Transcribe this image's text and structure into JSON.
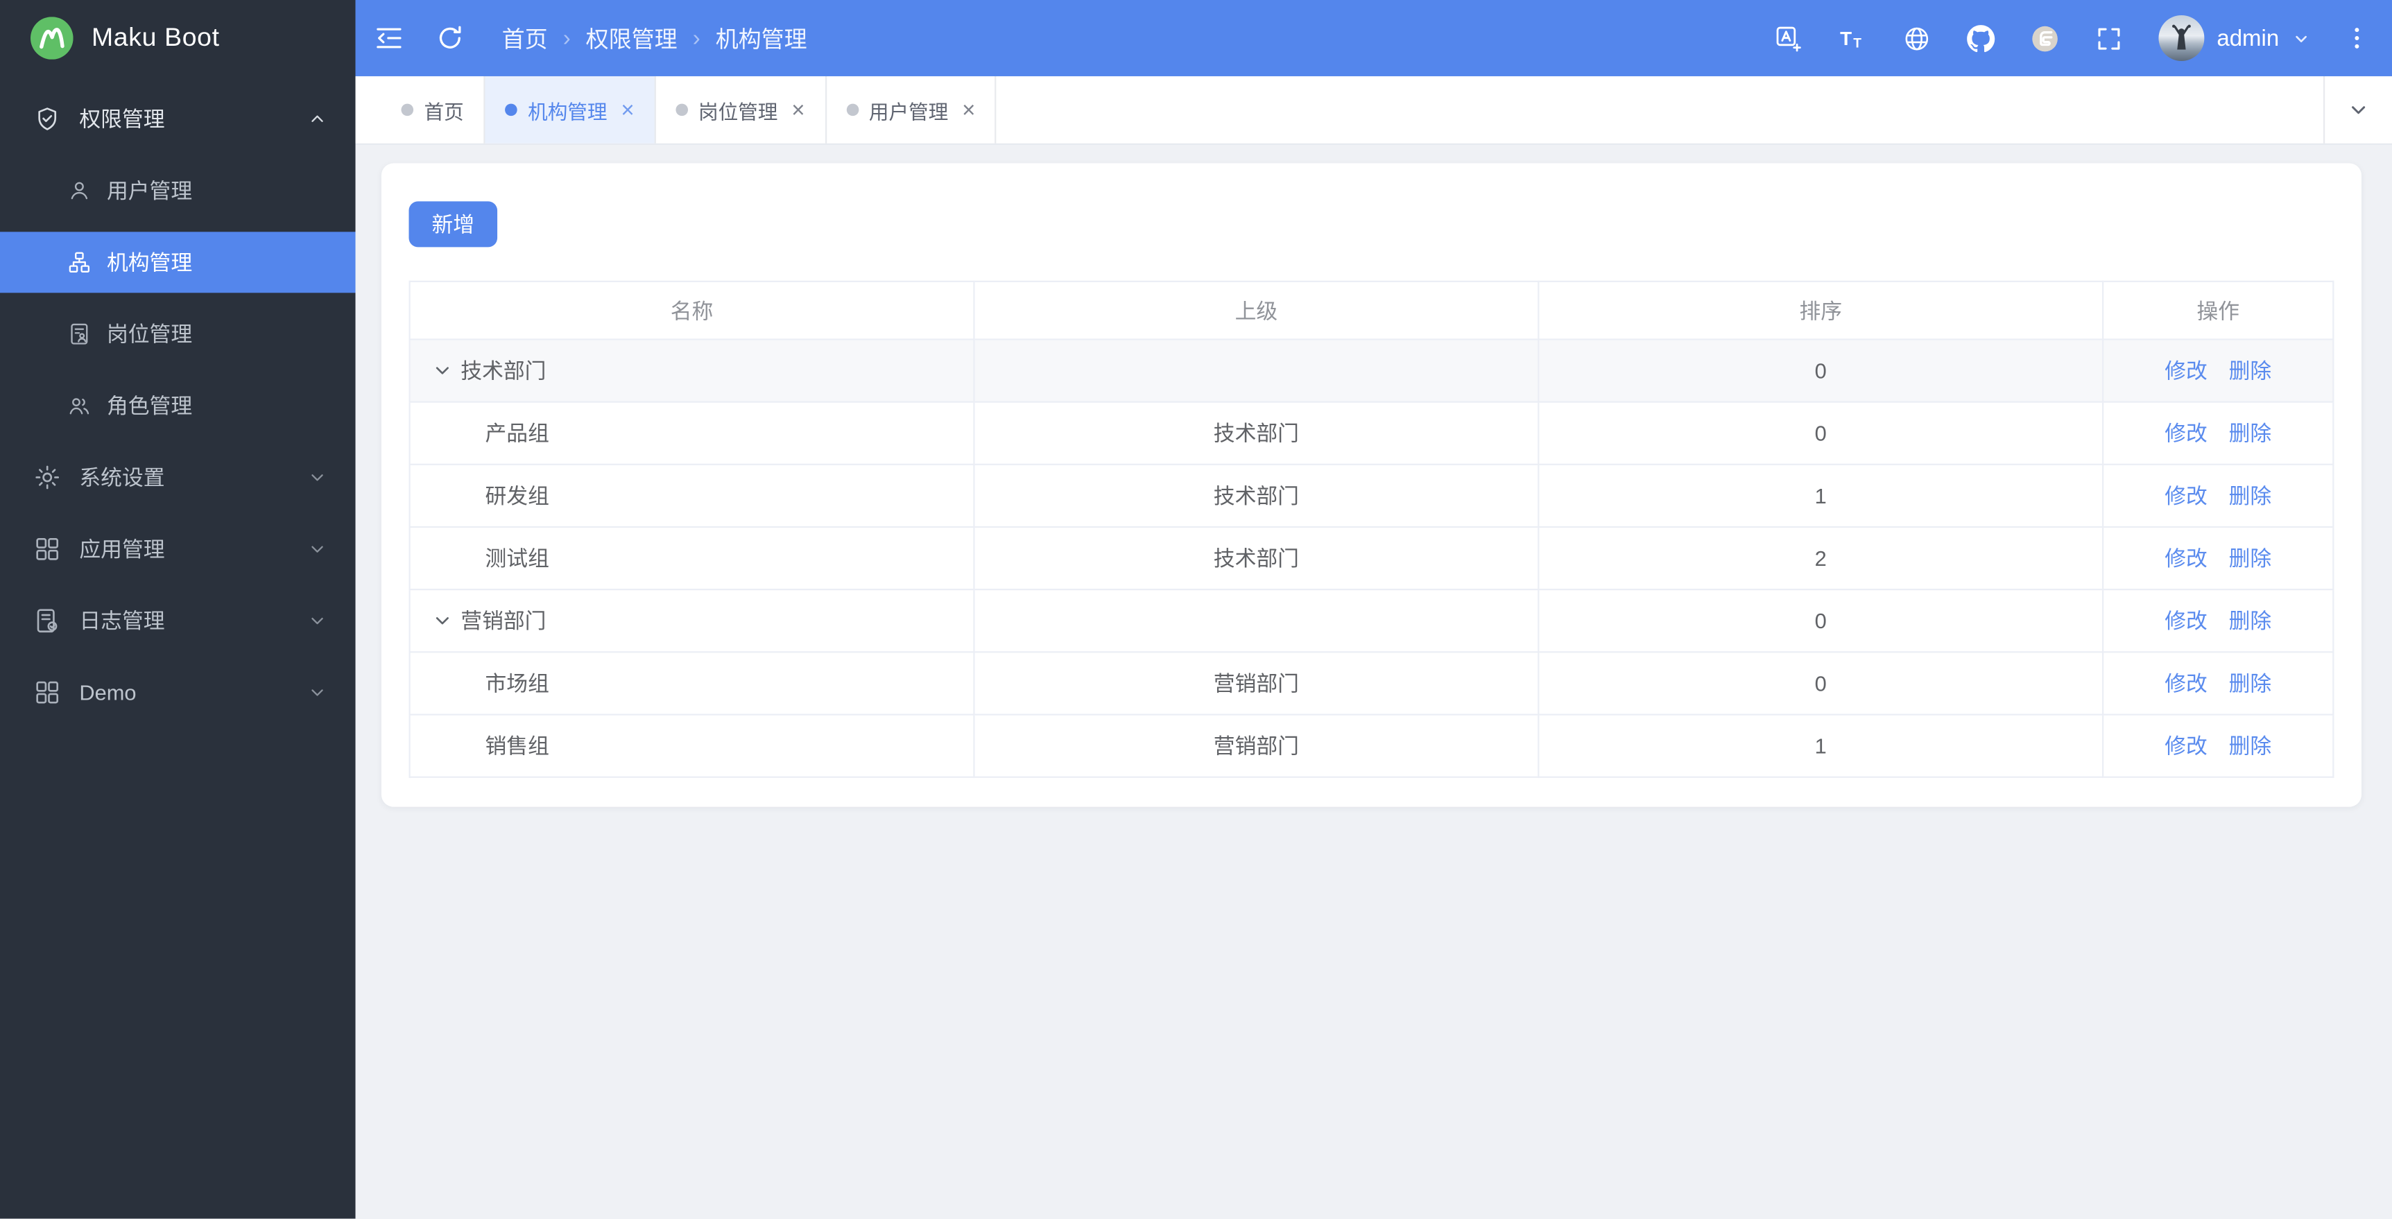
{
  "app": {
    "name": "Maku Boot",
    "logo_icon": "mountain-logo-icon"
  },
  "topbar": {
    "left_icons": [
      "sidebar-fold-icon",
      "refresh-icon"
    ],
    "breadcrumb": [
      "首页",
      "权限管理",
      "机构管理"
    ],
    "right_icons": [
      "translate-icon",
      "font-size-icon",
      "globe-icon",
      "github-icon",
      "gitee-icon",
      "fullscreen-icon"
    ],
    "username": "admin",
    "user_menu_icon": "chevron-down-icon",
    "more_icon": "more-vertical-icon"
  },
  "sidebar": {
    "sections": [
      {
        "key": "permissions",
        "label": "权限管理",
        "icon": "shield-check-icon",
        "expanded": true,
        "children": [
          {
            "key": "users",
            "label": "用户管理",
            "icon": "user-icon",
            "active": false
          },
          {
            "key": "orgs",
            "label": "机构管理",
            "icon": "org-chart-icon",
            "active": true
          },
          {
            "key": "posts",
            "label": "岗位管理",
            "icon": "post-icon",
            "active": false
          },
          {
            "key": "roles",
            "label": "角色管理",
            "icon": "roles-icon",
            "active": false
          }
        ]
      },
      {
        "key": "system",
        "label": "系统设置",
        "icon": "gear-icon",
        "expanded": false,
        "children": []
      },
      {
        "key": "apps",
        "label": "应用管理",
        "icon": "grid-icon",
        "expanded": false,
        "children": []
      },
      {
        "key": "logs",
        "label": "日志管理",
        "icon": "log-icon",
        "expanded": false,
        "children": []
      },
      {
        "key": "demo",
        "label": "Demo",
        "icon": "grid-icon",
        "expanded": false,
        "children": []
      }
    ]
  },
  "tabs": [
    {
      "label": "首页",
      "active": false,
      "closable": false
    },
    {
      "label": "机构管理",
      "active": true,
      "closable": true
    },
    {
      "label": "岗位管理",
      "active": false,
      "closable": true
    },
    {
      "label": "用户管理",
      "active": false,
      "closable": true
    }
  ],
  "page": {
    "add_button": "新增",
    "table": {
      "columns": [
        "名称",
        "上级",
        "排序",
        "操作"
      ],
      "actions": {
        "edit": "修改",
        "delete": "删除"
      },
      "rows": [
        {
          "name": "技术部门",
          "parent": "",
          "sort": "0",
          "level": 0,
          "expanded": true,
          "highlighted": true
        },
        {
          "name": "产品组",
          "parent": "技术部门",
          "sort": "0",
          "level": 1,
          "highlighted": false
        },
        {
          "name": "研发组",
          "parent": "技术部门",
          "sort": "1",
          "level": 1,
          "highlighted": false
        },
        {
          "name": "测试组",
          "parent": "技术部门",
          "sort": "2",
          "level": 1,
          "highlighted": false
        },
        {
          "name": "营销部门",
          "parent": "",
          "sort": "0",
          "level": 0,
          "expanded": true,
          "highlighted": false
        },
        {
          "name": "市场组",
          "parent": "营销部门",
          "sort": "0",
          "level": 1,
          "highlighted": false
        },
        {
          "name": "销售组",
          "parent": "营销部门",
          "sort": "1",
          "level": 1,
          "highlighted": false
        }
      ]
    }
  },
  "colors": {
    "primary": "#5486ec",
    "sidebar_bg": "#2a313c",
    "content_bg": "#eff1f5",
    "link": "#5a8bee",
    "tab_active_bg": "#e9f0fd",
    "logo_green": "#5fbf66"
  }
}
